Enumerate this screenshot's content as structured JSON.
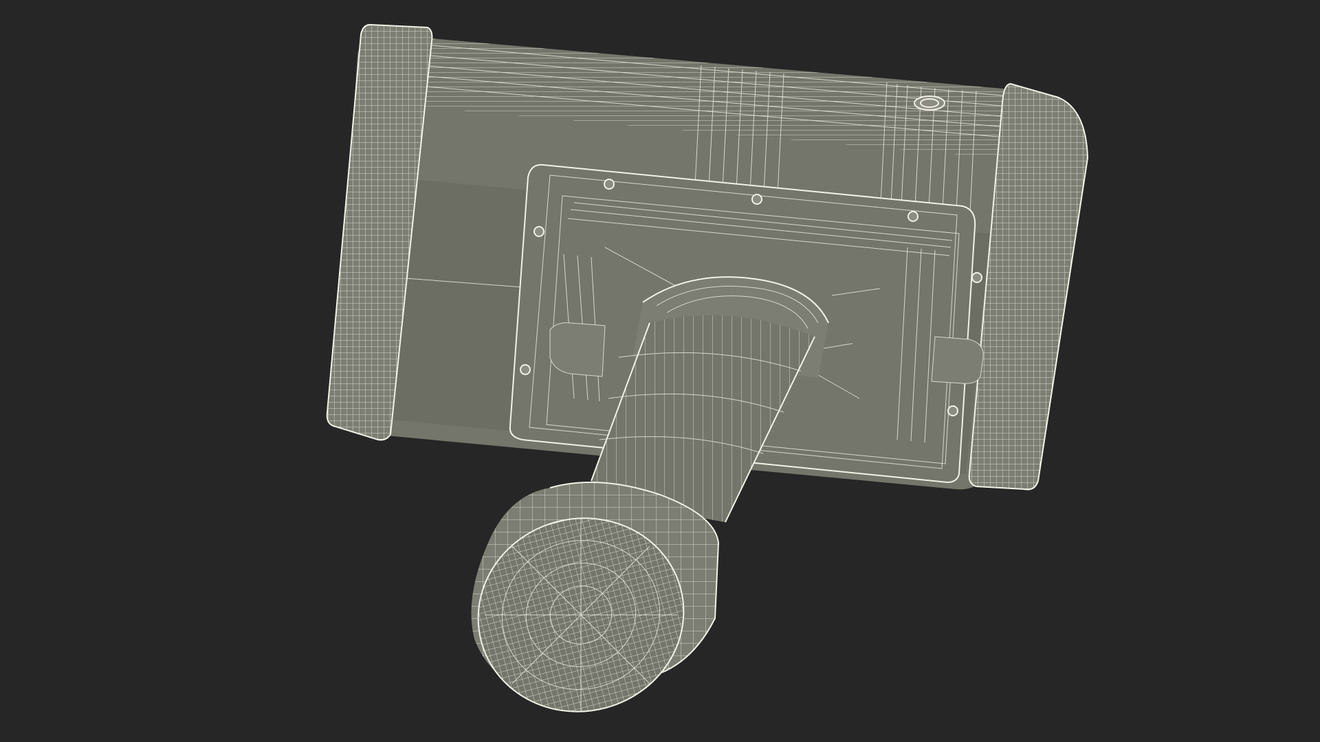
{
  "scene": {
    "background_color": "#262626",
    "mesh_color": "#74766b",
    "wire_color": "#e9e8dc",
    "object": "handheld-device-wireframe",
    "parts": [
      "housing",
      "left-end-cap",
      "right-end-cap",
      "back-panel",
      "mounting-screws",
      "top-port",
      "handle-neck",
      "handle-shaft",
      "knurled-grip-knob"
    ]
  }
}
